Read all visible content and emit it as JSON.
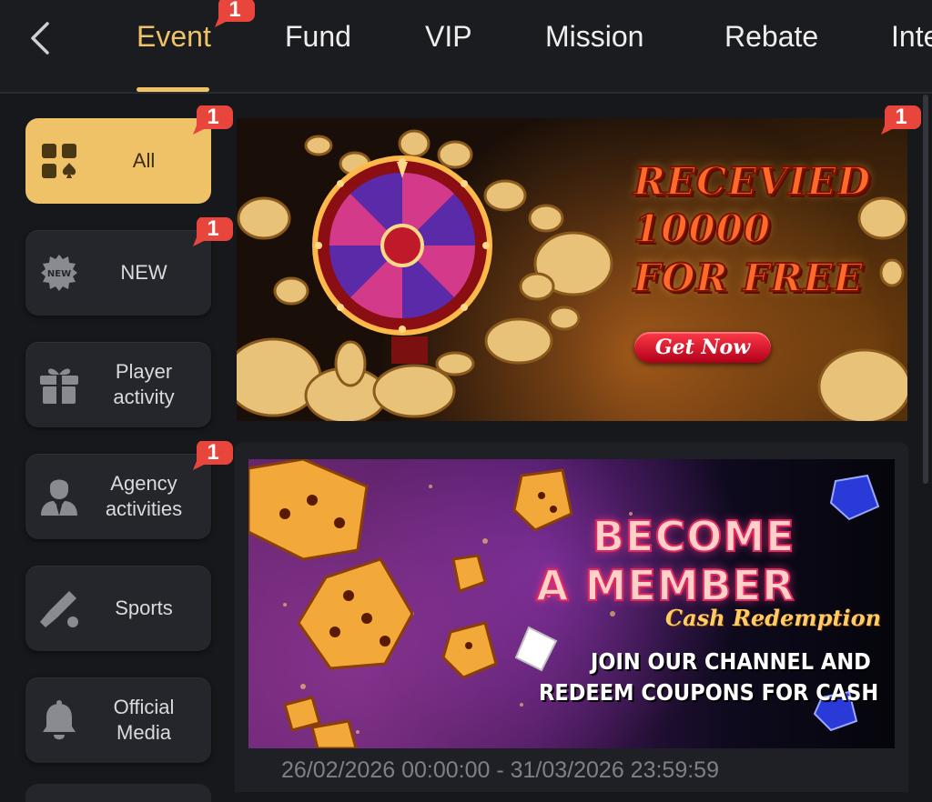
{
  "nav": {
    "tabs": [
      {
        "label": "Event",
        "badge": "1"
      },
      {
        "label": "Fund"
      },
      {
        "label": "VIP"
      },
      {
        "label": "Mission"
      },
      {
        "label": "Rebate"
      },
      {
        "label": "Inte"
      }
    ]
  },
  "sidebar": {
    "items": [
      {
        "label": "All",
        "badge": "1",
        "icon": "grid-icon"
      },
      {
        "label": "NEW",
        "badge": "1",
        "icon": "new-icon",
        "icon_text": "NEW"
      },
      {
        "label": "Player activity",
        "icon": "gift-icon"
      },
      {
        "label": "Agency activities",
        "badge": "1",
        "icon": "agent-icon"
      },
      {
        "label": "Sports",
        "icon": "cricket-bat-icon"
      },
      {
        "label": "Official Media",
        "icon": "bell-icon"
      }
    ]
  },
  "banners": [
    {
      "badge": "1",
      "lines": [
        "RECEVIED",
        "10000",
        "FOR FREE"
      ],
      "button": "Get Now"
    },
    {
      "title_lines": [
        "BECOME",
        "A MEMBER"
      ],
      "subtitle": "Cash Redemption",
      "text_lines": [
        "JOIN OUR CHANNEL AND",
        "REDEEM COUPONS FOR CASH"
      ],
      "date_range": "26/02/2026 00:00:00 - 31/03/2026 23:59:59"
    }
  ],
  "colors": {
    "accent": "#f0c267",
    "badge": "#e8453c",
    "background": "#17181c",
    "sidebar_item": "#24262c"
  }
}
